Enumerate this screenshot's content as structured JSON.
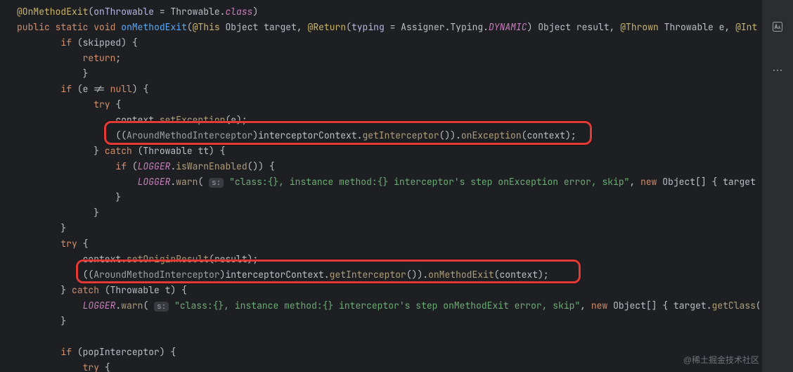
{
  "code": {
    "l1": {
      "ann": "@OnMethodExit",
      "p1": "(",
      "parm": "onThrowable",
      "eq": " = ",
      "t1": "Throwable",
      "dot": ".",
      "cls": "class",
      "p2": ")"
    },
    "l2": {
      "kw1": "public",
      "kw2": "static",
      "kw3": "void",
      "m": "onMethodExit",
      "p1": "(",
      "a1": "@This",
      "t1": " Object ",
      "id1": "target",
      "c1": ", ",
      "a2": "@Return",
      "p2": "(",
      "parm": "typing",
      "eq": " = ",
      "path": "Assigner.Typing.",
      "dyn": "DYNAMIC",
      "p3": ")",
      "t2": " Object ",
      "id2": "result",
      "c2": ", ",
      "a3": "@Thrown",
      "t3": " Throwable ",
      "id3": "e",
      "c3": ", ",
      "a4": "@Int"
    },
    "l3": {
      "kw": "if",
      "p1": " (",
      "id": "skipped",
      "p2": ") {"
    },
    "l4": {
      "kw": "return",
      "p": ";"
    },
    "l5": {
      "p": "}"
    },
    "l6": {
      "kw": "if",
      "p1": " (",
      "id": "e",
      "op": " != ",
      "kw2": "null",
      "p2": ") {"
    },
    "l7": {
      "kw": "try",
      "p": " {"
    },
    "l8": {
      "id": "context",
      "dot": ".",
      "call": "setException",
      "p1": "(",
      "arg": "e",
      "p2": ");"
    },
    "l9": {
      "p1": "((",
      "cast": "AroundMethodInterceptor",
      "p2": ")",
      "id": "interceptorContext",
      "dot": ".",
      "call1": "getInterceptor",
      "p3": "()).",
      "call2": "onException",
      "p4": "(",
      "arg": "context",
      "p5": ");"
    },
    "l10": {
      "p1": "} ",
      "kw": "catch",
      "p2": " (Throwable ",
      "id": "tt",
      "p3": ") {"
    },
    "l11": {
      "kw": "if",
      "p1": " (",
      "fld": "LOGGER",
      "dot": ".",
      "call": "isWarnEnabled",
      "p2": "()) {"
    },
    "l12": {
      "fld": "LOGGER",
      "dot": ".",
      "call": "warn",
      "p1": "( ",
      "hint": "s:",
      "sp": " ",
      "str": "\"class:{}, instance method:{} interceptor's step onException error, skip\"",
      "c": ", ",
      "kw": "new",
      "t": " Object[] { ",
      "id": "target"
    },
    "l13": {
      "p": "}"
    },
    "l14": {
      "p": "}"
    },
    "l15": {
      "p": "}"
    },
    "l16": {
      "kw": "try",
      "p": " {"
    },
    "l17": {
      "id": "context",
      "dot": ".",
      "call": "setOriginResult",
      "p1": "(",
      "arg": "result",
      "p2": ");"
    },
    "l18": {
      "p1": "((",
      "cast": "AroundMethodInterceptor",
      "p2": ")",
      "id": "interceptorContext",
      "dot": ".",
      "call1": "getInterceptor",
      "p3": "()).",
      "call2": "onMethodExit",
      "p4": "(",
      "arg": "context",
      "p5": ");"
    },
    "l19": {
      "p1": "} ",
      "kw": "catch",
      "p2": " (Throwable ",
      "id": "t",
      "p3": ") {"
    },
    "l20": {
      "fld": "LOGGER",
      "dot": ".",
      "call": "warn",
      "p1": "( ",
      "hint": "s:",
      "sp": " ",
      "str": "\"class:{}, instance method:{} interceptor's step onMethodExit error, skip\"",
      "c": ", ",
      "kw": "new",
      "t": " Object[] { ",
      "id": "target",
      "dot2": ".",
      "call2": "getClass",
      "p2": "()"
    },
    "l21": {
      "p": "}"
    },
    "l22blank": "",
    "l22": {
      "kw": "if",
      "p1": " (",
      "id": "popInterceptor",
      "p2": ") {"
    },
    "l23": {
      "kw": "try",
      "p": " {"
    }
  },
  "watermark": "@稀土掘金技术社区"
}
